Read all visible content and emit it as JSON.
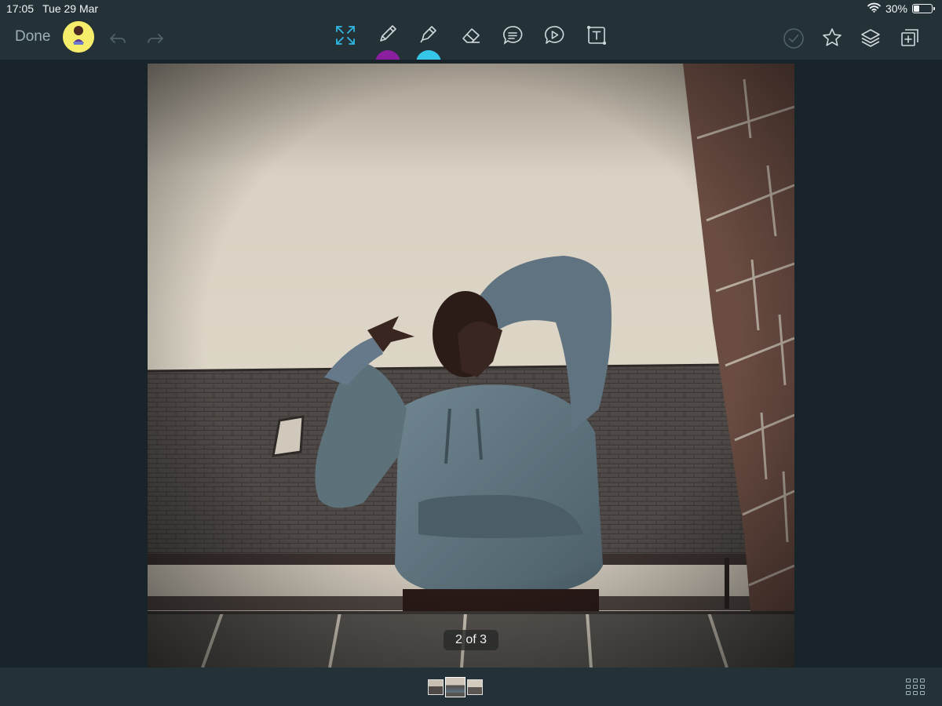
{
  "status_bar": {
    "time": "17:05",
    "date": "Tue 29 Mar",
    "battery_text": "30%",
    "battery_level": 0.3,
    "icons": [
      "wifi-icon",
      "battery-icon"
    ]
  },
  "toolbar": {
    "done_label": "Done",
    "tools": [
      {
        "name": "fit-screen-tool",
        "icon": "expand-arrows-icon",
        "active": true
      },
      {
        "name": "pencil-tool",
        "icon": "pencil-icon"
      },
      {
        "name": "marker-tool",
        "icon": "marker-pen-icon"
      },
      {
        "name": "eraser-tool",
        "icon": "eraser-icon"
      },
      {
        "name": "comment-tool",
        "icon": "speech-bubble-icon"
      },
      {
        "name": "audio-tool",
        "icon": "play-bubble-icon"
      },
      {
        "name": "text-box-tool",
        "icon": "text-box-icon"
      }
    ],
    "right_actions": [
      "checkmark-circle-icon",
      "star-icon",
      "layers-icon",
      "add-page-icon"
    ],
    "colors": {
      "accent": "#2fb6e6",
      "pencil_color": "#8c1fa0",
      "marker_color": "#35c6e8",
      "bar_background": "#243238",
      "canvas_background": "#18242a"
    }
  },
  "canvas": {
    "page_indicator": "2 of 3"
  },
  "bottom_bar": {
    "thumbnails": 3,
    "active_thumbnail": 2,
    "grid_icon": "grid-view-icon"
  }
}
